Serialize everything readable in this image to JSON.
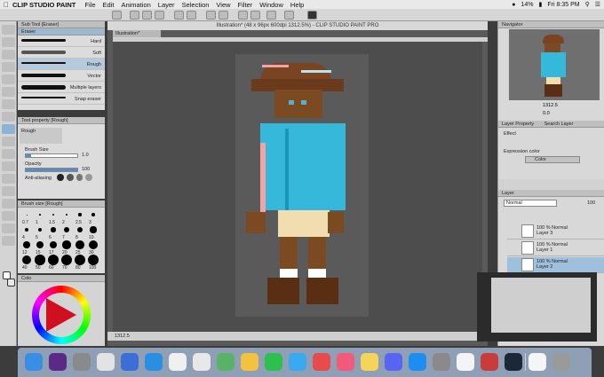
{
  "menubar": {
    "app": "CLIP STUDIO PAINT",
    "items": [
      "File",
      "Edit",
      "Animation",
      "Layer",
      "Selection",
      "View",
      "Filter",
      "Window",
      "Help"
    ],
    "battery": "14%",
    "clock": "Fri 8:35 PM"
  },
  "subtool": {
    "header": "Sub Tool [Eraser]",
    "group": "Eraser",
    "items": [
      {
        "label": "Hard"
      },
      {
        "label": "Soft"
      },
      {
        "label": "Rough"
      },
      {
        "label": "Vector"
      },
      {
        "label": "Multiple layers"
      },
      {
        "label": "Snap eraser"
      }
    ]
  },
  "toolprop": {
    "header": "Tool property [Rough]",
    "preset": "Rough",
    "brush_size_label": "Brush Size",
    "brush_size_value": "1.0",
    "opacity_label": "Opacity",
    "opacity_value": "100",
    "antialias_label": "Anti-aliasing"
  },
  "brushsize": {
    "header": "Brush size [Rough]",
    "sizes": [
      "0.7",
      "1",
      "1.5",
      "2",
      "2.5",
      "3",
      "4",
      "5",
      "6",
      "7",
      "8",
      "10",
      "12",
      "15",
      "17",
      "20",
      "25",
      "30",
      "40",
      "50",
      "60",
      "70",
      "80",
      "100"
    ]
  },
  "colorpanel": {
    "header": "Colo"
  },
  "document": {
    "title": "Illustration* (48 x 96px 600dpi 1312.5%) - CLIP STUDIO PAINT PRO",
    "tab": "Illustration*",
    "zoom": "1312.5"
  },
  "navigator": {
    "header": "Navigator",
    "zoom": "1312.5",
    "rotate": "0.0"
  },
  "layerprop": {
    "header": "Layer Property",
    "tab2": "Search Layer",
    "effect_label": "Effect",
    "expression_label": "Expression color",
    "expression_value": "Color"
  },
  "layers": {
    "header": "Layer",
    "blend": "Normal",
    "opacity": "100",
    "items": [
      {
        "mode": "100 % Normal",
        "name": "Layer 3"
      },
      {
        "mode": "100 % Normal",
        "name": "Layer 1"
      },
      {
        "mode": "100 % Normal",
        "name": "Layer 2"
      }
    ]
  },
  "dock": {
    "icons": [
      "finder-icon",
      "siri-icon",
      "launchpad-icon",
      "chrome-icon",
      "preview-icon",
      "safari-icon",
      "calendar-icon",
      "files-icon",
      "maps-icon",
      "photos-icon",
      "facetime-icon",
      "messages-icon",
      "news-icon",
      "music-icon",
      "notes-icon",
      "discord-icon",
      "appstore-icon",
      "settings-icon",
      "clipstudio-icon",
      "app-icon",
      "steam-icon",
      "document-icon",
      "trash-icon"
    ]
  }
}
